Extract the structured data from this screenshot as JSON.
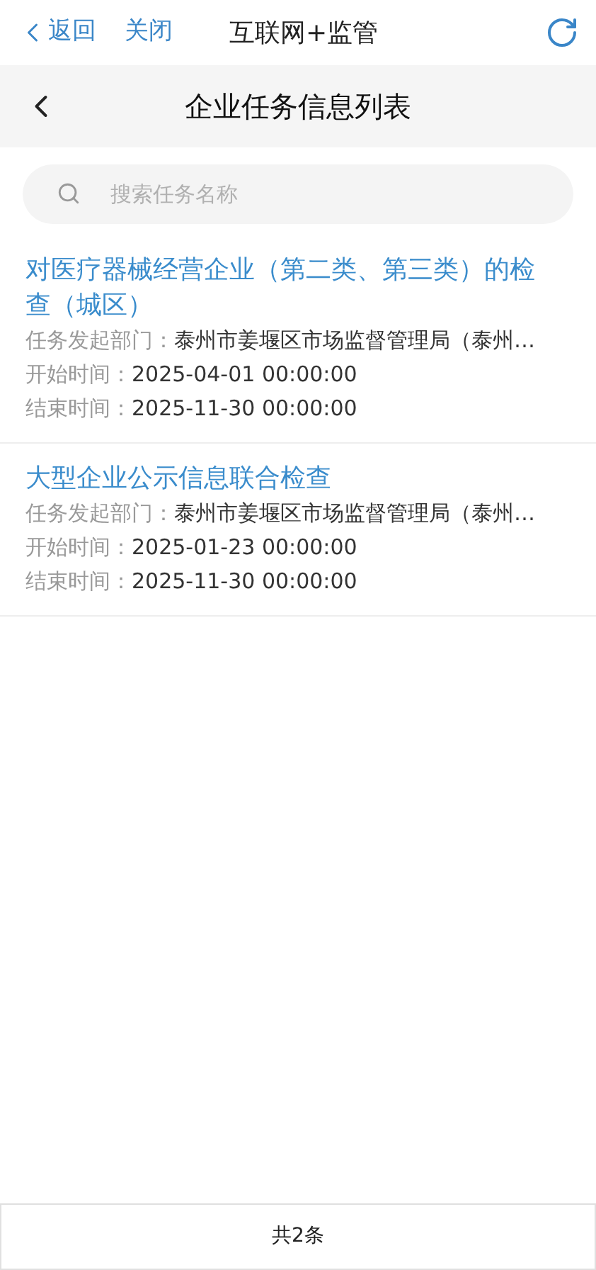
{
  "top_bar": {
    "back": "返回",
    "close": "关闭",
    "title": "互联网+监管"
  },
  "header": {
    "title": "企业任务信息列表"
  },
  "search": {
    "placeholder": "搜索任务名称"
  },
  "tasks": [
    {
      "title": "对医疗器械经营企业（第二类、第三类）的检查（城区）",
      "fields": [
        {
          "label": "任务发起部门：",
          "value": "泰州市姜堰区市场监督管理局（泰州…"
        },
        {
          "label": "开始时间：",
          "value": "2025-04-01 00:00:00"
        },
        {
          "label": "结束时间：",
          "value": "2025-11-30 00:00:00"
        }
      ]
    },
    {
      "title": "大型企业公示信息联合检查",
      "fields": [
        {
          "label": "任务发起部门：",
          "value": "泰州市姜堰区市场监督管理局（泰州…"
        },
        {
          "label": "开始时间：",
          "value": "2025-01-23 00:00:00"
        },
        {
          "label": "结束时间：",
          "value": "2025-11-30 00:00:00"
        }
      ]
    }
  ],
  "footer": {
    "count": "共2条"
  }
}
